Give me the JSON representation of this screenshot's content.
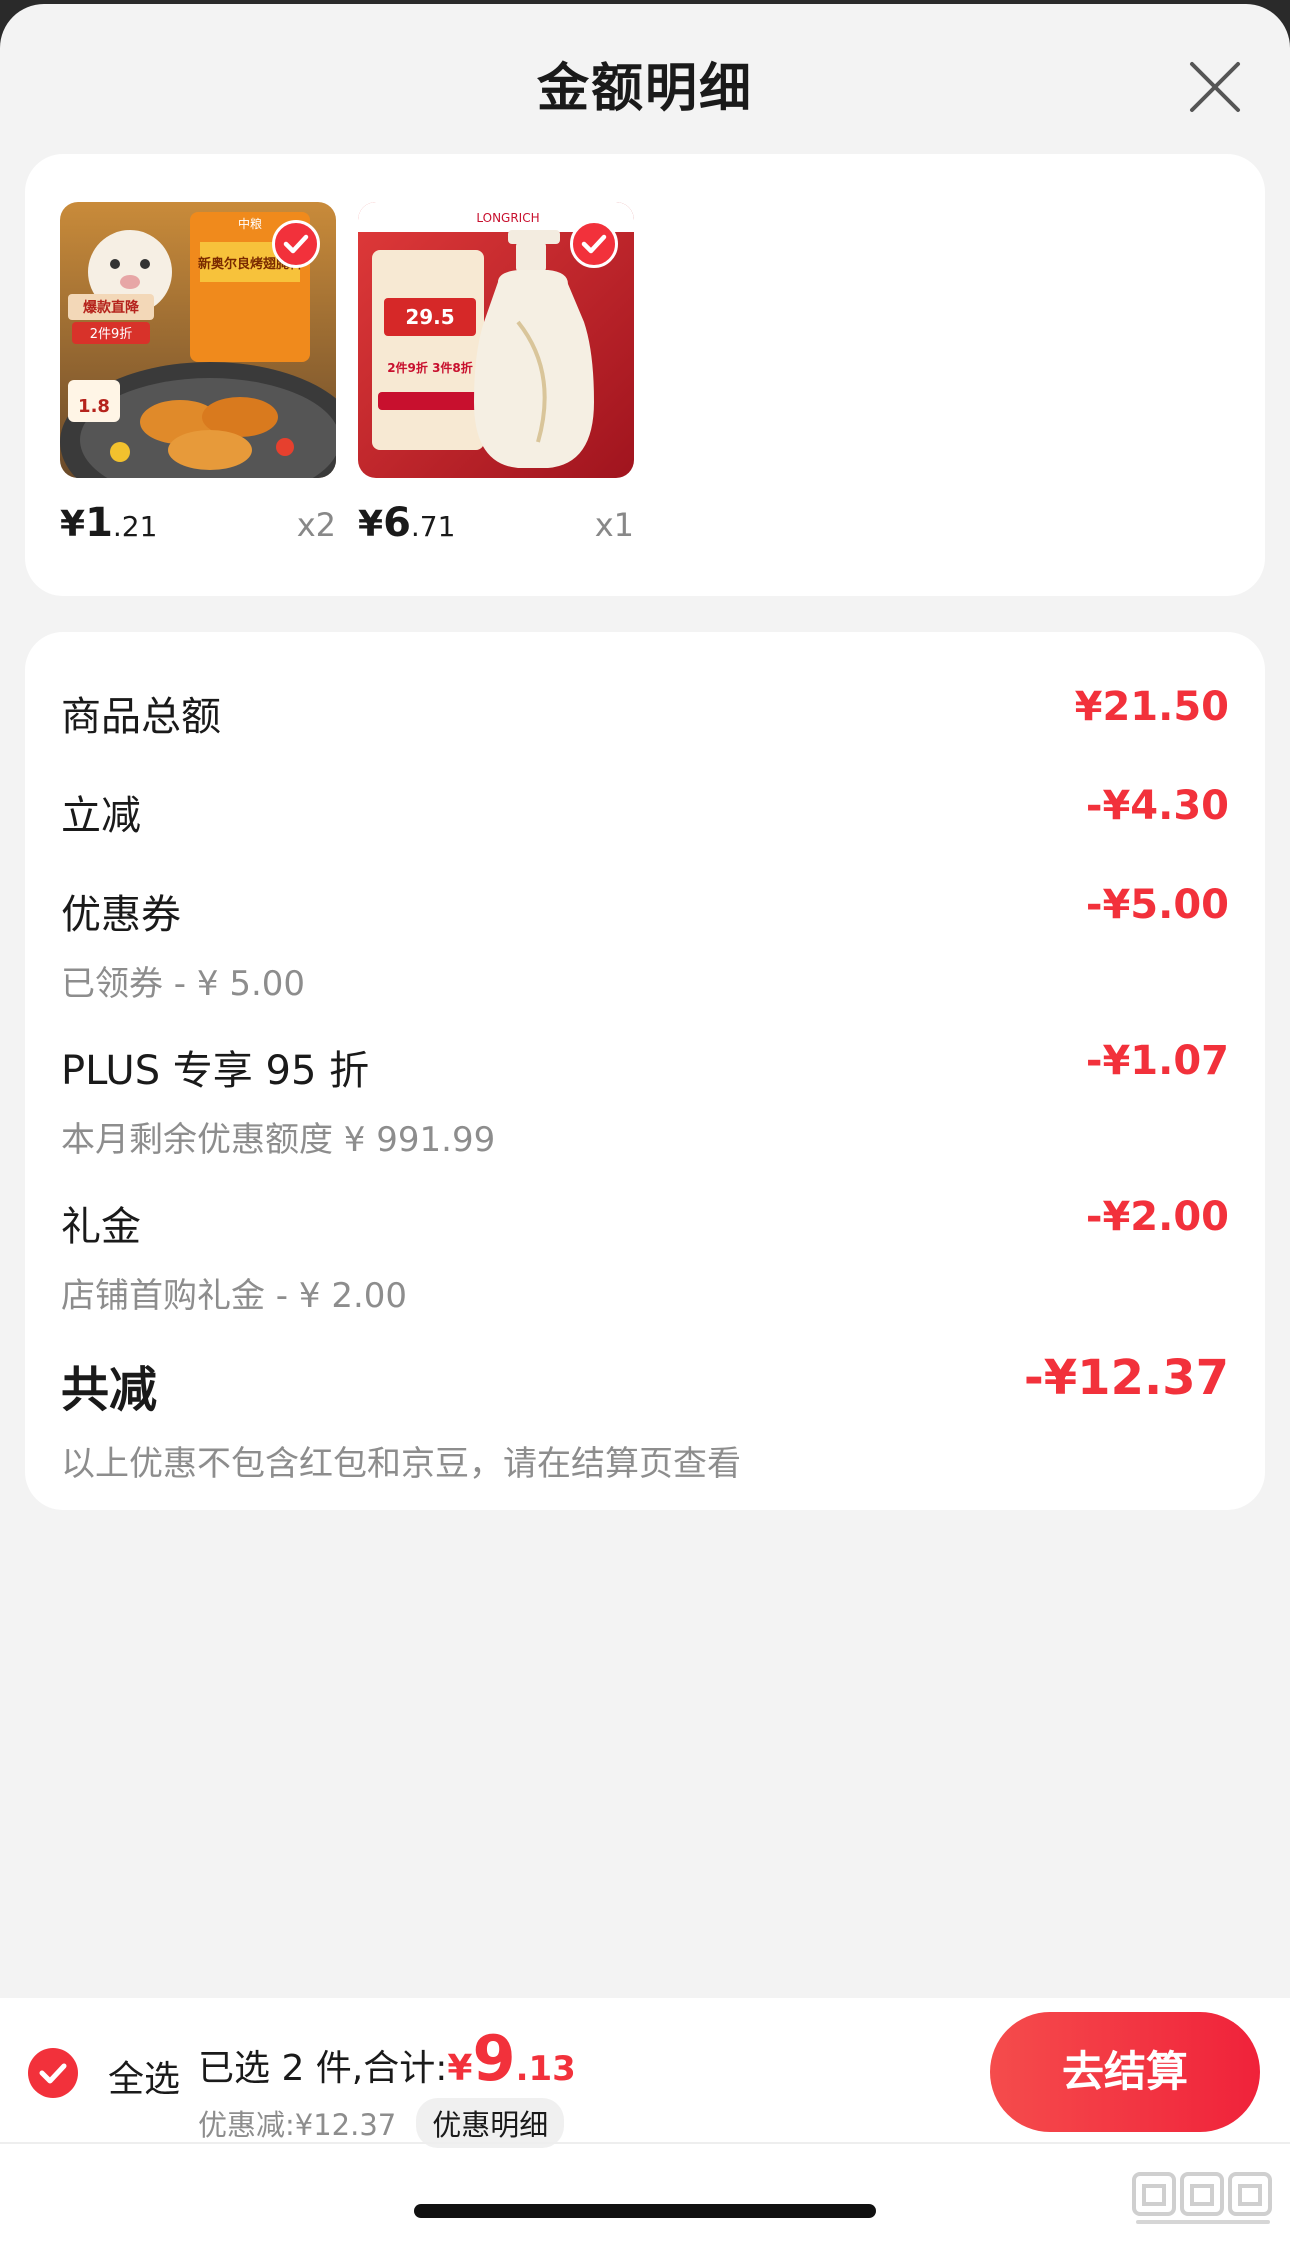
{
  "header": {
    "title": "金额明细"
  },
  "products": [
    {
      "price_currency": "¥",
      "price_int": "1",
      "price_dec": ".21",
      "qty": "x2",
      "selected": true,
      "image_icon": "chicken-wing-seasoning-image"
    },
    {
      "price_currency": "¥",
      "price_int": "6",
      "price_dec": ".71",
      "qty": "x1",
      "selected": true,
      "image_icon": "shower-gel-bottle-image"
    }
  ],
  "product_image_text": {
    "p1_tag": "爆款直降",
    "p1_promo": "2件9折",
    "p1_pack": "新奥尔良烤翅腌料",
    "p1_brand": "中粮",
    "p1_price": "1.8",
    "p2_brand": "LONGRICH",
    "p2_price": "29.5",
    "p2_promo": "2件9折 3件8折"
  },
  "breakdown": {
    "items": [
      {
        "label": "商品总额",
        "amount": "¥21.50",
        "sub": ""
      },
      {
        "label": "立减",
        "amount": "-¥4.30",
        "sub": ""
      },
      {
        "label": "优惠券",
        "amount": "-¥5.00",
        "sub": "已领券 - ¥ 5.00"
      },
      {
        "label": "PLUS 专享 95 折",
        "amount": "-¥1.07",
        "sub": "本月剩余优惠额度  ¥ 991.99"
      },
      {
        "label": "礼金",
        "amount": "-¥2.00",
        "sub": "店铺首购礼金 - ¥ 2.00"
      }
    ],
    "total": {
      "label": "共减",
      "amount": "-¥12.37",
      "note": "以上优惠不包含红包和京豆，请在结算页查看"
    }
  },
  "bottom_bar": {
    "select_all_label": "全选",
    "selected_count_text": "已选 2 件,合计:",
    "total_currency": "¥",
    "total_int": "9",
    "total_dec": ".13",
    "discount_text": "优惠减:¥12.37",
    "detail_link": "优惠明细",
    "checkout_label": "去结算"
  },
  "colors": {
    "accent": "#f2313b",
    "background": "#f3f3f3",
    "card": "#ffffff"
  },
  "icons": {
    "close": "close-icon",
    "check": "check-icon"
  }
}
